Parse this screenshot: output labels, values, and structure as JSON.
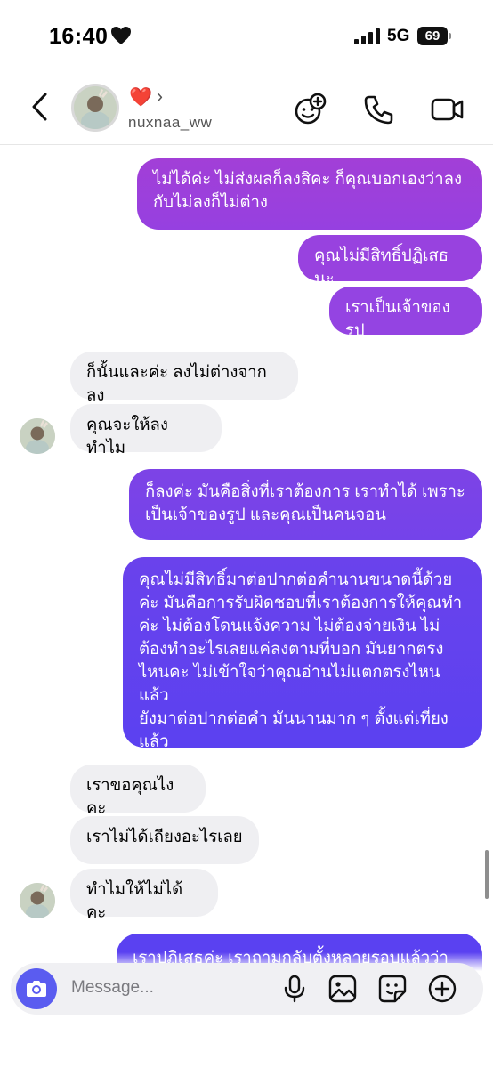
{
  "status": {
    "time": "16:40",
    "network": "5G",
    "battery": "69"
  },
  "header": {
    "title_emoji": "❤️",
    "chevron": "›",
    "username": "nuxnaa_ww"
  },
  "messages": [
    {
      "side": "out",
      "lines": [
        "ไม่ได้ค่ะ ไม่ส่งผลก็ลงสิคะ ก็คุณบอกเองว่าลง",
        "กับไม่ลงก็ไม่ต่าง"
      ]
    },
    {
      "side": "out",
      "lines": [
        "คุณไม่มีสิทธิ์ปฏิเสธนะ"
      ]
    },
    {
      "side": "out",
      "lines": [
        "เราเป็นเจ้าของรูป"
      ]
    },
    {
      "side": "in",
      "lines": [
        "ก็นั้นและค่ะ ลงไม่ต่างจากลง"
      ]
    },
    {
      "side": "in",
      "lines": [
        "คุณจะให้ลงทำไม"
      ]
    },
    {
      "side": "out",
      "lines": [
        "ก็ลงค่ะ มันคือสิ่งที่เราต้องการ เราทำได้ เพราะ",
        "เป็นเจ้าของรูป และคุณเป็นคนจอน"
      ]
    },
    {
      "side": "out",
      "lines": [
        "คุณไม่มีสิทธิ์มาต่อปากต่อคำนานขนาดนี้ด้วย",
        "ค่ะ มันคือการรับผิดชอบที่เราต้องการให้คุณทำ",
        "ค่ะ ไม่ต้องโดนแจ้งความ ไม่ต้องจ่ายเงิน ไม่",
        "ต้องทำอะไรเลยแค่ลงตามที่บอก มันยากตรง",
        "ไหนคะ ไม่เข้าใจว่าคุณอ่านไม่แตกตรงไหนแล้ว",
        "ยังมาต่อปากต่อคำ มันนานมาก ๆ ตั้งแต่เที่ยง",
        "แล้ว"
      ]
    },
    {
      "side": "in",
      "lines": [
        "เราขอคุณไงคะ"
      ]
    },
    {
      "side": "in",
      "lines": [
        "เราไม่ได้เถียงอะไรเลย"
      ]
    },
    {
      "side": "in",
      "lines": [
        "ทำไมให้ไม่ได้คะ"
      ]
    },
    {
      "side": "out",
      "lines": [
        "เราปฏิเสธค่ะ เราถามกลับตั้งหลายรอบแล้วว่า"
      ]
    }
  ],
  "composer": {
    "placeholder": "Message..."
  },
  "colors": {
    "out_top": "#9b3fd9",
    "out_bottom": "#5b3ff0",
    "in_bg": "#efeff2",
    "accent": "#5a5cf0"
  },
  "icons": [
    "back-arrow-icon",
    "add-sticker-face-icon",
    "phone-icon",
    "video-camera-icon",
    "camera-icon",
    "microphone-icon",
    "gallery-icon",
    "sticker-icon",
    "plus-icon"
  ]
}
